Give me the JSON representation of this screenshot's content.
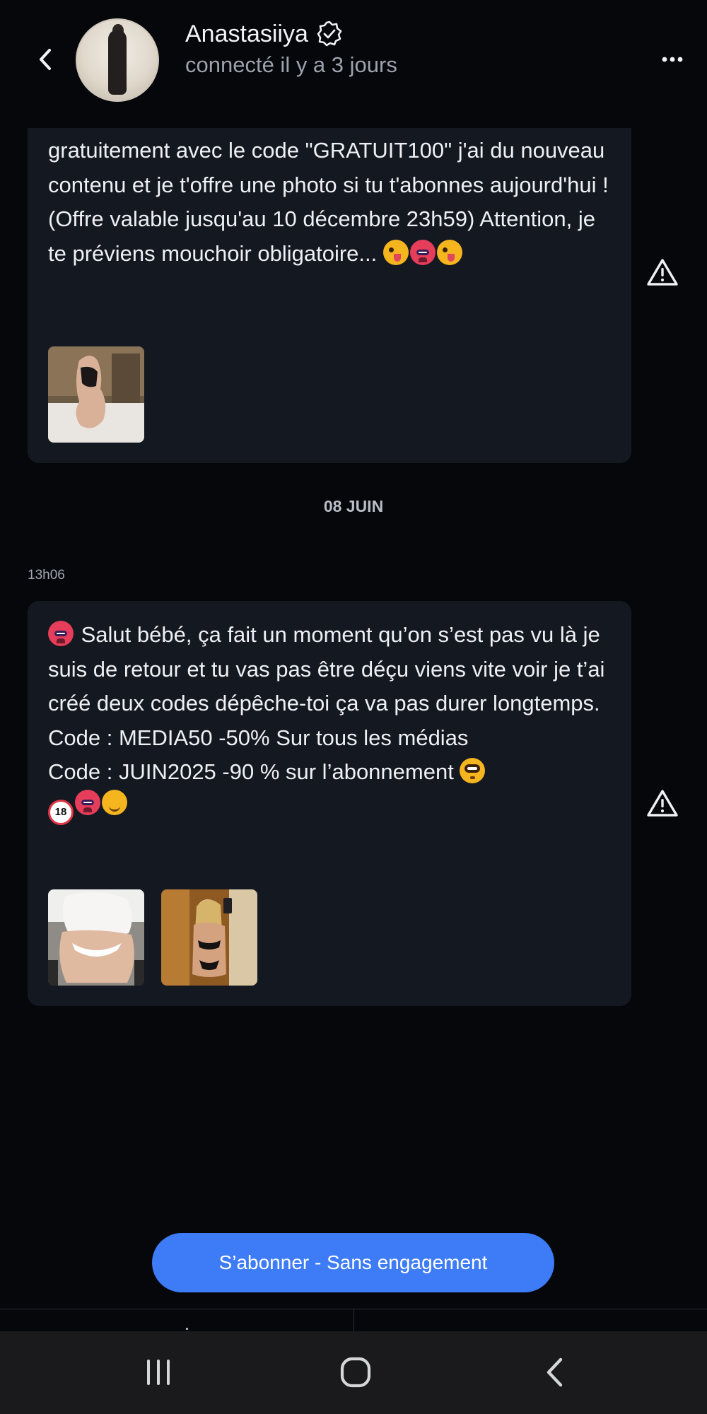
{
  "header": {
    "contact_name": "Anastasiiya",
    "verified_icon": "verified-check-icon",
    "status": "connecté il y a 3 jours",
    "back_icon": "chevron-left-icon",
    "more_icon": "more-horizontal-icon"
  },
  "messages": [
    {
      "text": "gratuitement avec le code \"GRATUIT100\" j'ai du nouveau contenu et je t'offre une photo si tu t'abonnes aujourd'hui ! (Offre valable jusqu'au 10 décembre 23h59) Attention, je te préviens mouchoir obligatoire...",
      "emojis": [
        "winking-face-tongue",
        "hot-face",
        "winking-face-tongue"
      ],
      "media_count": 1,
      "alert_icon": "warning-triangle-icon"
    },
    {
      "timestamp": "13h06",
      "lead_emoji": "hot-face",
      "text_lines": [
        "Salut bébé, ça fait un moment qu’on s’est pas vu là je suis de retour et tu vas pas être déçu viens vite voir je t’ai créé deux codes dépêche-toi ça va pas durer longtemps.",
        "Code : MEDIA50 -50% Sur tous les médias",
        "Code : JUIN2025 -90 % sur l’abonnement"
      ],
      "trailing_emojis": [
        "no-one-under-eighteen",
        "hot-face",
        "smirking-face"
      ],
      "eighteen_label": "18",
      "media_count": 2,
      "alert_icon": "warning-triangle-icon"
    }
  ],
  "date_separator": "08 JUIN",
  "subscribe_button": "S’abonner - Sans engagement",
  "colors": {
    "background": "#06070b",
    "bubble": "#141821",
    "accent": "#3d7bf7",
    "muted_text": "#9da2ac"
  },
  "system_nav": {
    "recents_icon": "recents-icon",
    "home_icon": "home-icon",
    "back_icon": "system-back-icon"
  }
}
